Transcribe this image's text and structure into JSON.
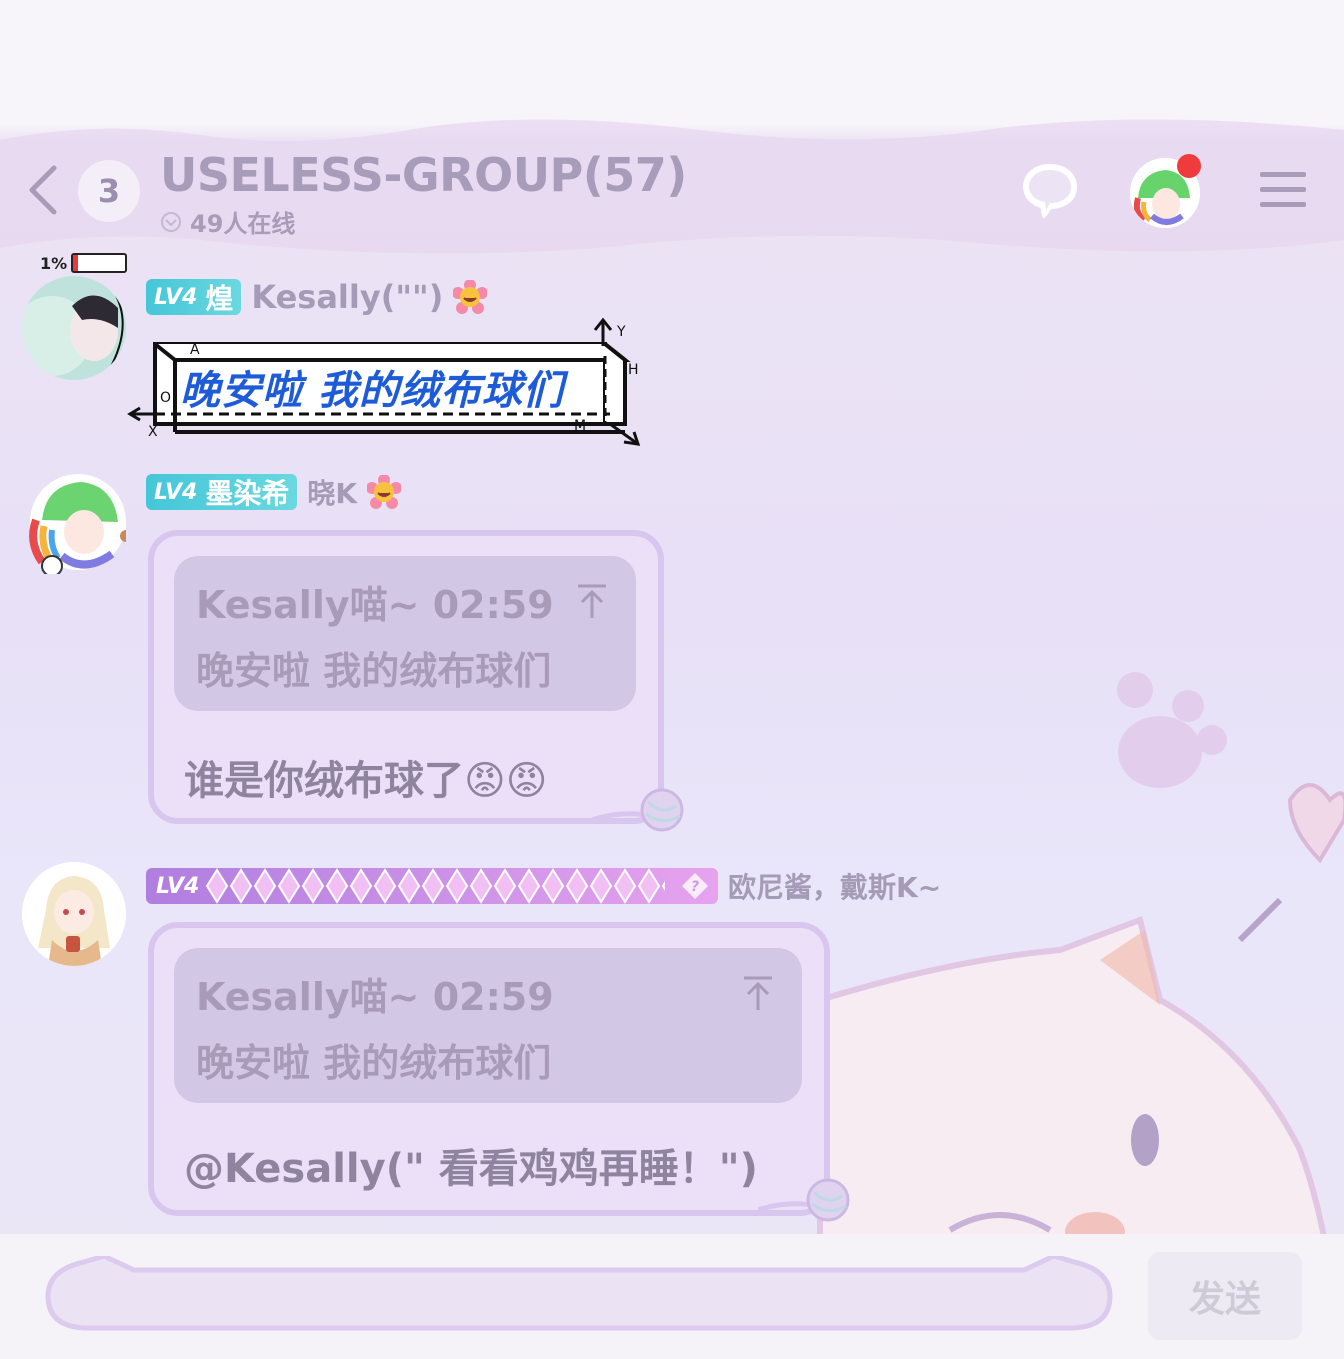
{
  "header": {
    "back_icon": "chevron-left-icon",
    "unread_count": "3",
    "group_title": "USELESS-GROUP(57)",
    "online_text": "49人在线",
    "chat_icon": "speech-bubble-icon",
    "menu_icon": "hamburger-menu-icon"
  },
  "status": {
    "battery_text": "1%",
    "battery_level": 0.1
  },
  "messages": [
    {
      "level": "LV4",
      "level_title": "煌",
      "sender": "Kesally(\"\")",
      "sticker_text": "晚安啦 我的绒布球们",
      "sticker_labels": {
        "a": "A",
        "y": "Y",
        "h": "H",
        "o": "O",
        "x": "X",
        "m": "M"
      }
    },
    {
      "level": "LV4",
      "level_title": "墨染希",
      "sender": "晓K",
      "quote_header": "Kesally喵~ 02:59",
      "quote_body": "晚安啦 我的绒布球们",
      "text": "谁是你绒布球了😡😡"
    },
    {
      "level": "LV4",
      "sender": "欧尼酱，戴斯K~",
      "quote_header": "Kesally喵~ 02:59",
      "quote_body": "晚安啦 我的绒布球们",
      "text": "@Kesally(\" 看看鸡鸡再睡！\")"
    }
  ],
  "input": {
    "placeholder": "",
    "send_label": "发送"
  },
  "colors": {
    "accent": "#a89cbb",
    "bubble_border": "#d9c6ee",
    "notif": "#ef3b3b"
  }
}
